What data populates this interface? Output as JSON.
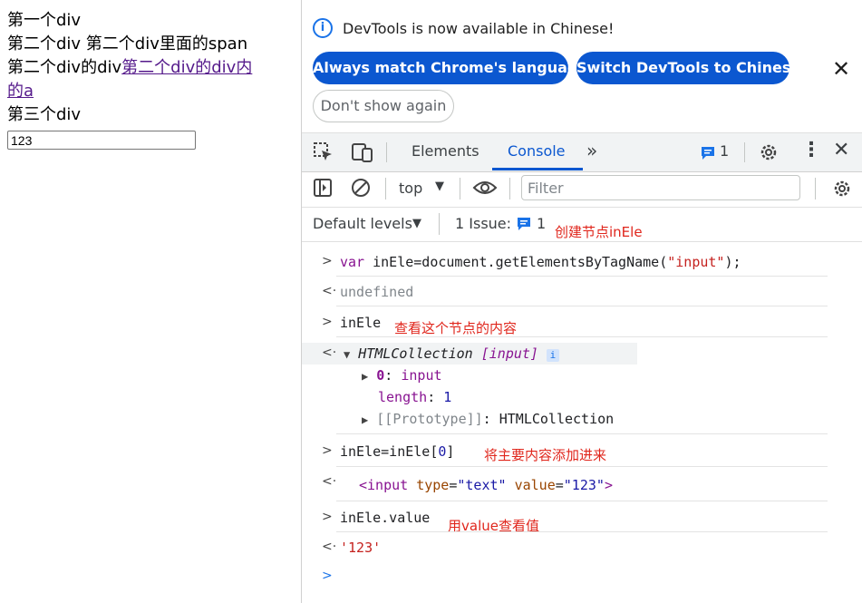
{
  "page": {
    "line1": "第一个div",
    "line2": "第二个div 第二个div里面的span",
    "line3_prefix": "第二个div的div",
    "line3_link": "第二个div的div内",
    "line3_link2": "的a",
    "line4": "第三个div",
    "input_value": "123"
  },
  "infobar": {
    "text": "DevTools is now available in Chinese!",
    "btn_match": "Always match Chrome's language",
    "btn_switch": "Switch DevTools to Chinese",
    "btn_dont": "Don't show again"
  },
  "tabs": {
    "elements": "Elements",
    "console": "Console",
    "more": "»",
    "issues_count": "1"
  },
  "toolbar": {
    "context": "top",
    "filter_placeholder": "Filter"
  },
  "levels": {
    "default_levels": "Default levels",
    "issues_label": "1 Issue:",
    "issues_count": "1"
  },
  "console": {
    "cmd1_var": "var ",
    "cmd1_rest": "inEle=document.getElementsByTagName(",
    "cmd1_str": "\"input\"",
    "cmd1_end": ");",
    "out1": "undefined",
    "cmd2": "inEle",
    "out2_type": "HTMLCollection",
    "out2_tag": "[input]",
    "out2_item_key": "0",
    "out2_item_val": "input",
    "out2_len_key": "length",
    "out2_len_val": "1",
    "out2_proto_key": "[[Prototype]]",
    "out2_proto_val": "HTMLCollection",
    "cmd3_a": "inEle=inEle[",
    "cmd3_b": "0",
    "cmd3_c": "]",
    "out3_open": "<input ",
    "out3_a1": "type",
    "out3_v1": "\"text\"",
    "out3_a2": "value",
    "out3_v2": "\"123\"",
    "out3_close": ">",
    "cmd4": "inEle.value",
    "out4": "'123'"
  },
  "notes": {
    "n1": "创建节点inEle",
    "n2": "查看这个节点的内容",
    "n3": "将主要内容添加进来",
    "n4": "用value查看值"
  }
}
